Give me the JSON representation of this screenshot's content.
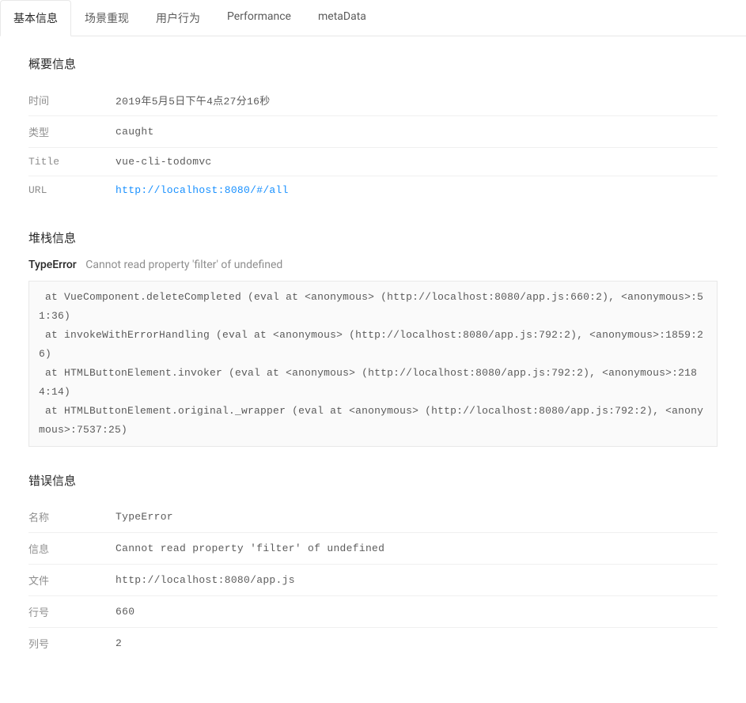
{
  "tabs": [
    {
      "label": "基本信息",
      "active": true
    },
    {
      "label": "场景重现",
      "active": false
    },
    {
      "label": "用户行为",
      "active": false
    },
    {
      "label": "Performance",
      "active": false
    },
    {
      "label": "metaData",
      "active": false
    }
  ],
  "overview": {
    "title": "概要信息",
    "rows": [
      {
        "label": "时间",
        "value": "2019年5月5日下午4点27分16秒"
      },
      {
        "label": "类型",
        "value": "caught"
      },
      {
        "label": "Title",
        "value": "vue-cli-todomvc"
      },
      {
        "label": "URL",
        "value": "http://localhost:8080/#/all",
        "link": true
      }
    ]
  },
  "stack": {
    "title": "堆栈信息",
    "error_type": "TypeError",
    "error_msg": "Cannot read property 'filter' of undefined",
    "trace": " at VueComponent.deleteCompleted (eval at <anonymous> (http://localhost:8080/app.js:660:2), <anonymous>:51:36)\n at invokeWithErrorHandling (eval at <anonymous> (http://localhost:8080/app.js:792:2), <anonymous>:1859:26)\n at HTMLButtonElement.invoker (eval at <anonymous> (http://localhost:8080/app.js:792:2), <anonymous>:2184:14)\n at HTMLButtonElement.original._wrapper (eval at <anonymous> (http://localhost:8080/app.js:792:2), <anonymous>:7537:25)"
  },
  "error": {
    "title": "错误信息",
    "rows": [
      {
        "label": "名称",
        "value": "TypeError"
      },
      {
        "label": "信息",
        "value": "Cannot read property 'filter' of undefined"
      },
      {
        "label": "文件",
        "value": "http://localhost:8080/app.js"
      },
      {
        "label": "行号",
        "value": "660"
      },
      {
        "label": "列号",
        "value": "2"
      }
    ]
  }
}
